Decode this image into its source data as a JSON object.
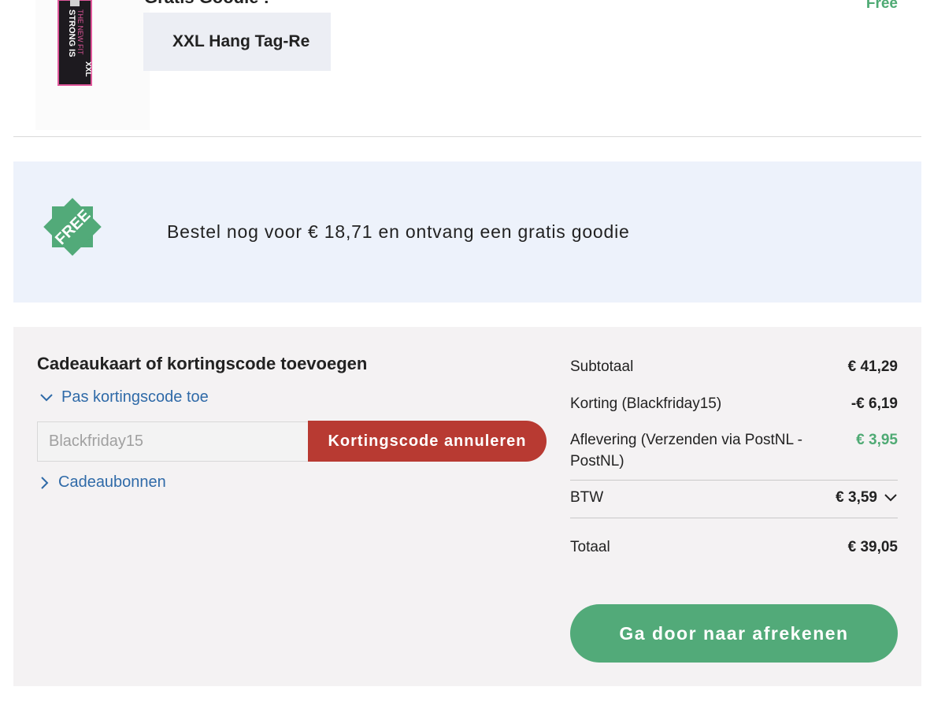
{
  "product": {
    "title": "Gratis Goodie :",
    "variant": "XXL Hang Tag-Re",
    "price": "Free",
    "tag_lines": [
      "STRONG IS",
      "THE NEW FIT",
      "XXL"
    ]
  },
  "promo": {
    "badge": "FREE",
    "text": "Bestel nog voor € 18,71 en ontvang een gratis goodie"
  },
  "coupon": {
    "heading": "Cadeaukaart of kortingscode toevoegen",
    "toggle_label": "Pas kortingscode toe",
    "input_value": "Blackfriday15",
    "cancel_label": "Kortingscode annuleren",
    "gift_label": "Cadeaubonnen"
  },
  "totals": {
    "subtotal_label": "Subtotaal",
    "subtotal_value": "€ 41,29",
    "discount_label": "Korting (Blackfriday15)",
    "discount_value": "-€ 6,19",
    "shipping_label": "Aflevering (Verzenden via PostNL - PostNL)",
    "shipping_value": "€ 3,95",
    "vat_label": "BTW",
    "vat_value": "€ 3,59",
    "total_label": "Totaal",
    "total_value": "€ 39,05"
  },
  "checkout": {
    "label": "Ga door naar afrekenen"
  },
  "colors": {
    "brand_green": "#52aa79",
    "cancel_red": "#b83a32",
    "link_blue": "#2f6aa8",
    "banner_bg": "#edf2fb",
    "panel_bg": "#f4f2f3"
  }
}
